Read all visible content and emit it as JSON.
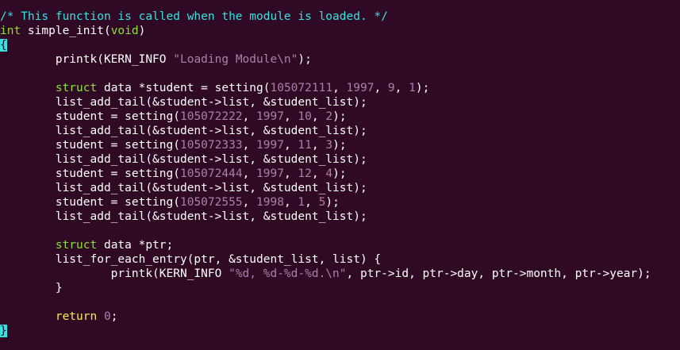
{
  "editor": {
    "lines": [
      {
        "kind": "comment-line",
        "tokens": [
          {
            "t": "/* This function is called when the module is loaded. */",
            "c": "comment"
          }
        ]
      },
      {
        "kind": "function-signature",
        "tokens": [
          {
            "t": "int",
            "c": "type"
          },
          {
            "t": " simple_init(",
            "c": "plain"
          },
          {
            "t": "void",
            "c": "type"
          },
          {
            "t": ")",
            "c": "plain"
          }
        ]
      },
      {
        "kind": "brace-line",
        "tokens": [
          {
            "t": "{",
            "c": "cursor"
          }
        ]
      },
      {
        "kind": "code-line",
        "tokens": [
          {
            "t": "        printk(KERN_INFO ",
            "c": "plain"
          },
          {
            "t": "\"Loading Module\\n\"",
            "c": "string"
          },
          {
            "t": ");",
            "c": "plain"
          }
        ]
      },
      {
        "kind": "blank-line",
        "tokens": []
      },
      {
        "kind": "code-line",
        "tokens": [
          {
            "t": "        ",
            "c": "plain"
          },
          {
            "t": "struct",
            "c": "type"
          },
          {
            "t": " data *student = setting(",
            "c": "plain"
          },
          {
            "t": "105072111",
            "c": "number"
          },
          {
            "t": ", ",
            "c": "plain"
          },
          {
            "t": "1997",
            "c": "number"
          },
          {
            "t": ", ",
            "c": "plain"
          },
          {
            "t": "9",
            "c": "number"
          },
          {
            "t": ", ",
            "c": "plain"
          },
          {
            "t": "1",
            "c": "number"
          },
          {
            "t": ");",
            "c": "plain"
          }
        ]
      },
      {
        "kind": "code-line",
        "tokens": [
          {
            "t": "        list_add_tail(&student->list, &student_list);",
            "c": "plain"
          }
        ]
      },
      {
        "kind": "code-line",
        "tokens": [
          {
            "t": "        student = setting(",
            "c": "plain"
          },
          {
            "t": "105072222",
            "c": "number"
          },
          {
            "t": ", ",
            "c": "plain"
          },
          {
            "t": "1997",
            "c": "number"
          },
          {
            "t": ", ",
            "c": "plain"
          },
          {
            "t": "10",
            "c": "number"
          },
          {
            "t": ", ",
            "c": "plain"
          },
          {
            "t": "2",
            "c": "number"
          },
          {
            "t": ");",
            "c": "plain"
          }
        ]
      },
      {
        "kind": "code-line",
        "tokens": [
          {
            "t": "        list_add_tail(&student->list, &student_list);",
            "c": "plain"
          }
        ]
      },
      {
        "kind": "code-line",
        "tokens": [
          {
            "t": "        student = setting(",
            "c": "plain"
          },
          {
            "t": "105072333",
            "c": "number"
          },
          {
            "t": ", ",
            "c": "plain"
          },
          {
            "t": "1997",
            "c": "number"
          },
          {
            "t": ", ",
            "c": "plain"
          },
          {
            "t": "11",
            "c": "number"
          },
          {
            "t": ", ",
            "c": "plain"
          },
          {
            "t": "3",
            "c": "number"
          },
          {
            "t": ");",
            "c": "plain"
          }
        ]
      },
      {
        "kind": "code-line",
        "tokens": [
          {
            "t": "        list_add_tail(&student->list, &student_list);",
            "c": "plain"
          }
        ]
      },
      {
        "kind": "code-line",
        "tokens": [
          {
            "t": "        student = setting(",
            "c": "plain"
          },
          {
            "t": "105072444",
            "c": "number"
          },
          {
            "t": ", ",
            "c": "plain"
          },
          {
            "t": "1997",
            "c": "number"
          },
          {
            "t": ", ",
            "c": "plain"
          },
          {
            "t": "12",
            "c": "number"
          },
          {
            "t": ", ",
            "c": "plain"
          },
          {
            "t": "4",
            "c": "number"
          },
          {
            "t": ");",
            "c": "plain"
          }
        ]
      },
      {
        "kind": "code-line",
        "tokens": [
          {
            "t": "        list_add_tail(&student->list, &student_list);",
            "c": "plain"
          }
        ]
      },
      {
        "kind": "code-line",
        "tokens": [
          {
            "t": "        student = setting(",
            "c": "plain"
          },
          {
            "t": "105072555",
            "c": "number"
          },
          {
            "t": ", ",
            "c": "plain"
          },
          {
            "t": "1998",
            "c": "number"
          },
          {
            "t": ", ",
            "c": "plain"
          },
          {
            "t": "1",
            "c": "number"
          },
          {
            "t": ", ",
            "c": "plain"
          },
          {
            "t": "5",
            "c": "number"
          },
          {
            "t": ");",
            "c": "plain"
          }
        ]
      },
      {
        "kind": "code-line",
        "tokens": [
          {
            "t": "        list_add_tail(&student->list, &student_list);",
            "c": "plain"
          }
        ]
      },
      {
        "kind": "blank-line",
        "tokens": []
      },
      {
        "kind": "code-line",
        "tokens": [
          {
            "t": "        ",
            "c": "plain"
          },
          {
            "t": "struct",
            "c": "type"
          },
          {
            "t": " data *ptr;",
            "c": "plain"
          }
        ]
      },
      {
        "kind": "code-line",
        "tokens": [
          {
            "t": "        list_for_each_entry(ptr, &student_list, list) {",
            "c": "plain"
          }
        ]
      },
      {
        "kind": "code-line",
        "tokens": [
          {
            "t": "                printk(KERN_INFO ",
            "c": "plain"
          },
          {
            "t": "\"%d, %d-%d-%d.\\n\"",
            "c": "string"
          },
          {
            "t": ", ptr->id, ptr->day, ptr->month, ptr->year);",
            "c": "plain"
          }
        ]
      },
      {
        "kind": "code-line",
        "tokens": [
          {
            "t": "        }",
            "c": "plain"
          }
        ]
      },
      {
        "kind": "blank-line",
        "tokens": []
      },
      {
        "kind": "code-line",
        "tokens": [
          {
            "t": "        ",
            "c": "plain"
          },
          {
            "t": "return",
            "c": "keyword"
          },
          {
            "t": " ",
            "c": "plain"
          },
          {
            "t": "0",
            "c": "number"
          },
          {
            "t": ";",
            "c": "plain"
          }
        ]
      },
      {
        "kind": "brace-line",
        "tokens": [
          {
            "t": "}",
            "c": "cursor"
          }
        ]
      }
    ]
  },
  "colors": {
    "background": "#300a24",
    "comment": "#34e2e2",
    "type": "#8ae234",
    "keyword": "#fce94f",
    "string": "#ad7fa8",
    "number": "#ad7fa8",
    "plain": "#ffffff",
    "cursor": "#34e2e2"
  }
}
